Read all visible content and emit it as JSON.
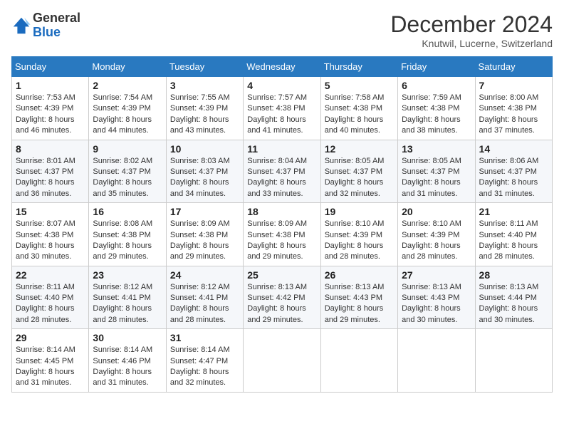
{
  "header": {
    "logo_general": "General",
    "logo_blue": "Blue",
    "month_title": "December 2024",
    "subtitle": "Knutwil, Lucerne, Switzerland"
  },
  "days_of_week": [
    "Sunday",
    "Monday",
    "Tuesday",
    "Wednesday",
    "Thursday",
    "Friday",
    "Saturday"
  ],
  "weeks": [
    [
      {
        "day": "1",
        "sunrise": "7:53 AM",
        "sunset": "4:39 PM",
        "daylight": "8 hours and 46 minutes."
      },
      {
        "day": "2",
        "sunrise": "7:54 AM",
        "sunset": "4:39 PM",
        "daylight": "8 hours and 44 minutes."
      },
      {
        "day": "3",
        "sunrise": "7:55 AM",
        "sunset": "4:39 PM",
        "daylight": "8 hours and 43 minutes."
      },
      {
        "day": "4",
        "sunrise": "7:57 AM",
        "sunset": "4:38 PM",
        "daylight": "8 hours and 41 minutes."
      },
      {
        "day": "5",
        "sunrise": "7:58 AM",
        "sunset": "4:38 PM",
        "daylight": "8 hours and 40 minutes."
      },
      {
        "day": "6",
        "sunrise": "7:59 AM",
        "sunset": "4:38 PM",
        "daylight": "8 hours and 38 minutes."
      },
      {
        "day": "7",
        "sunrise": "8:00 AM",
        "sunset": "4:38 PM",
        "daylight": "8 hours and 37 minutes."
      }
    ],
    [
      {
        "day": "8",
        "sunrise": "8:01 AM",
        "sunset": "4:37 PM",
        "daylight": "8 hours and 36 minutes."
      },
      {
        "day": "9",
        "sunrise": "8:02 AM",
        "sunset": "4:37 PM",
        "daylight": "8 hours and 35 minutes."
      },
      {
        "day": "10",
        "sunrise": "8:03 AM",
        "sunset": "4:37 PM",
        "daylight": "8 hours and 34 minutes."
      },
      {
        "day": "11",
        "sunrise": "8:04 AM",
        "sunset": "4:37 PM",
        "daylight": "8 hours and 33 minutes."
      },
      {
        "day": "12",
        "sunrise": "8:05 AM",
        "sunset": "4:37 PM",
        "daylight": "8 hours and 32 minutes."
      },
      {
        "day": "13",
        "sunrise": "8:05 AM",
        "sunset": "4:37 PM",
        "daylight": "8 hours and 31 minutes."
      },
      {
        "day": "14",
        "sunrise": "8:06 AM",
        "sunset": "4:37 PM",
        "daylight": "8 hours and 31 minutes."
      }
    ],
    [
      {
        "day": "15",
        "sunrise": "8:07 AM",
        "sunset": "4:38 PM",
        "daylight": "8 hours and 30 minutes."
      },
      {
        "day": "16",
        "sunrise": "8:08 AM",
        "sunset": "4:38 PM",
        "daylight": "8 hours and 29 minutes."
      },
      {
        "day": "17",
        "sunrise": "8:09 AM",
        "sunset": "4:38 PM",
        "daylight": "8 hours and 29 minutes."
      },
      {
        "day": "18",
        "sunrise": "8:09 AM",
        "sunset": "4:38 PM",
        "daylight": "8 hours and 29 minutes."
      },
      {
        "day": "19",
        "sunrise": "8:10 AM",
        "sunset": "4:39 PM",
        "daylight": "8 hours and 28 minutes."
      },
      {
        "day": "20",
        "sunrise": "8:10 AM",
        "sunset": "4:39 PM",
        "daylight": "8 hours and 28 minutes."
      },
      {
        "day": "21",
        "sunrise": "8:11 AM",
        "sunset": "4:40 PM",
        "daylight": "8 hours and 28 minutes."
      }
    ],
    [
      {
        "day": "22",
        "sunrise": "8:11 AM",
        "sunset": "4:40 PM",
        "daylight": "8 hours and 28 minutes."
      },
      {
        "day": "23",
        "sunrise": "8:12 AM",
        "sunset": "4:41 PM",
        "daylight": "8 hours and 28 minutes."
      },
      {
        "day": "24",
        "sunrise": "8:12 AM",
        "sunset": "4:41 PM",
        "daylight": "8 hours and 28 minutes."
      },
      {
        "day": "25",
        "sunrise": "8:13 AM",
        "sunset": "4:42 PM",
        "daylight": "8 hours and 29 minutes."
      },
      {
        "day": "26",
        "sunrise": "8:13 AM",
        "sunset": "4:43 PM",
        "daylight": "8 hours and 29 minutes."
      },
      {
        "day": "27",
        "sunrise": "8:13 AM",
        "sunset": "4:43 PM",
        "daylight": "8 hours and 30 minutes."
      },
      {
        "day": "28",
        "sunrise": "8:13 AM",
        "sunset": "4:44 PM",
        "daylight": "8 hours and 30 minutes."
      }
    ],
    [
      {
        "day": "29",
        "sunrise": "8:14 AM",
        "sunset": "4:45 PM",
        "daylight": "8 hours and 31 minutes."
      },
      {
        "day": "30",
        "sunrise": "8:14 AM",
        "sunset": "4:46 PM",
        "daylight": "8 hours and 31 minutes."
      },
      {
        "day": "31",
        "sunrise": "8:14 AM",
        "sunset": "4:47 PM",
        "daylight": "8 hours and 32 minutes."
      },
      null,
      null,
      null,
      null
    ]
  ],
  "labels": {
    "sunrise": "Sunrise:",
    "sunset": "Sunset:",
    "daylight": "Daylight:"
  }
}
